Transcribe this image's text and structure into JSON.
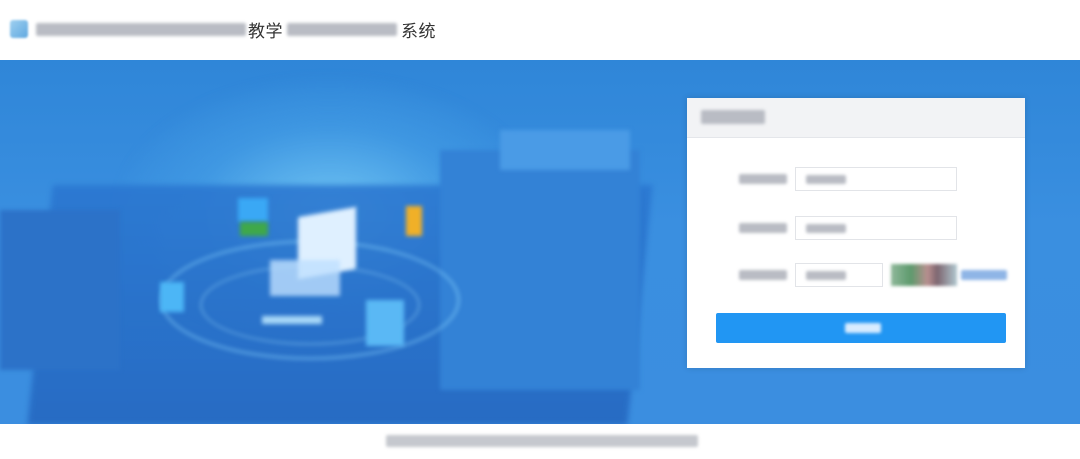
{
  "header": {
    "logo_icon": "school-logo-icon",
    "title_part1": "教学",
    "title_part2": "系统"
  },
  "colors": {
    "banner_blue": "#3a8fe0",
    "primary_button": "#2196f3"
  }
}
